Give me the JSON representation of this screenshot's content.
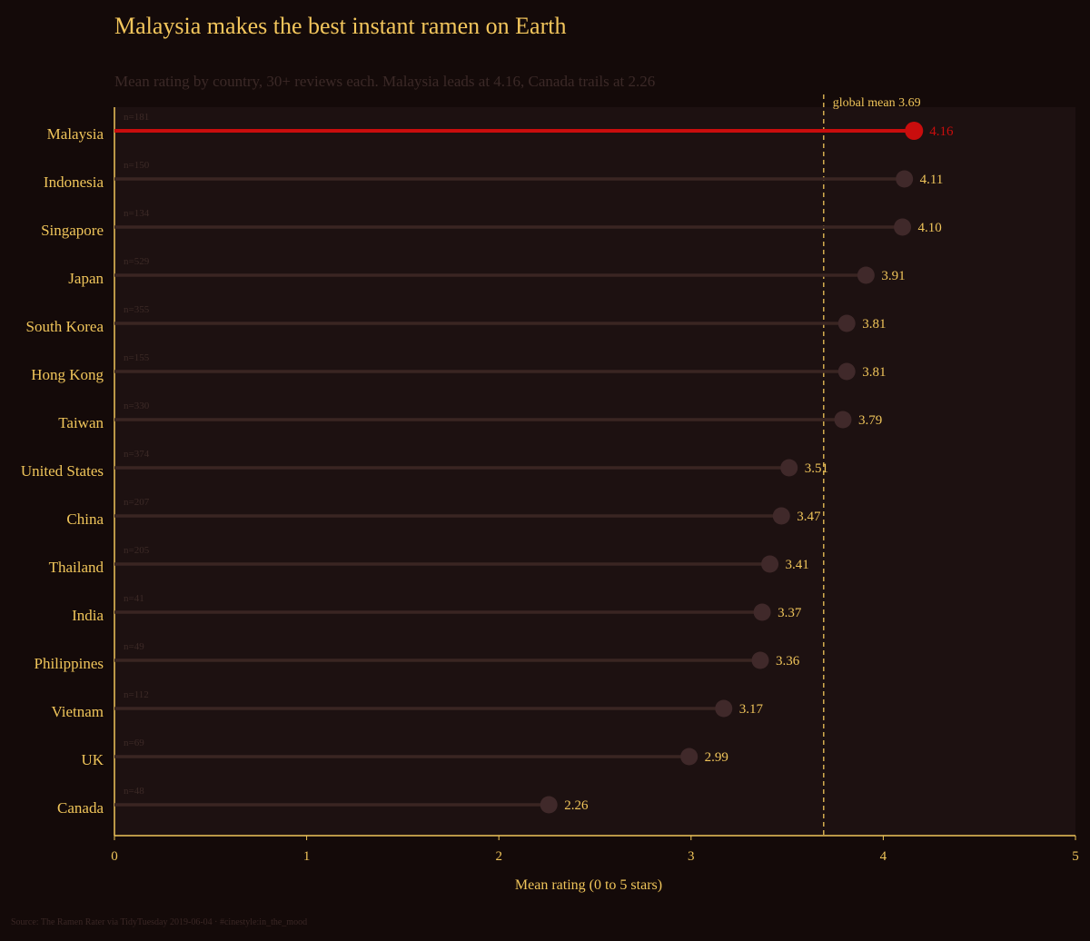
{
  "title": "Malaysia makes the best instant ramen on Earth",
  "subtitle": "Mean rating by country, 30+ reviews each. Malaysia leads at 4.16, Canada trails at 2.26",
  "caption": "Source: The Ramen Rater via TidyTuesday 2019-06-04 · #cinestyle:in_the_mood",
  "colors": {
    "background": "#140a09",
    "panel": "#1d1111",
    "accent": "#f0c55a",
    "highlight": "#c90d0d",
    "stem": "#3a2522",
    "dot": "#40292a",
    "muted": "#3d2a27"
  },
  "chart_data": {
    "type": "lollipop",
    "xlabel": "Mean rating (0 to 5 stars)",
    "xlim": [
      0,
      5
    ],
    "xticks": [
      0,
      1,
      2,
      3,
      4,
      5
    ],
    "reference_line": {
      "value": 3.69,
      "label": "global mean 3.69"
    },
    "highlight": "Malaysia",
    "categories": [
      "Malaysia",
      "Indonesia",
      "Singapore",
      "Japan",
      "South Korea",
      "Hong Kong",
      "Taiwan",
      "United States",
      "China",
      "Thailand",
      "India",
      "Philippines",
      "Vietnam",
      "UK",
      "Canada"
    ],
    "values": [
      4.16,
      4.11,
      4.1,
      3.91,
      3.81,
      3.81,
      3.79,
      3.51,
      3.47,
      3.41,
      3.37,
      3.36,
      3.17,
      2.99,
      2.26
    ],
    "value_labels": [
      "4.16",
      "4.11",
      "4.10",
      "3.91",
      "3.81",
      "3.81",
      "3.79",
      "3.51",
      "3.47",
      "3.41",
      "3.37",
      "3.36",
      "3.17",
      "2.99",
      "2.26"
    ],
    "counts": [
      "n=181",
      "n=150",
      "n=134",
      "n=529",
      "n=355",
      "n=155",
      "n=330",
      "n=374",
      "n=207",
      "n=205",
      "n=41",
      "n=49",
      "n=112",
      "n=69",
      "n=48"
    ]
  }
}
